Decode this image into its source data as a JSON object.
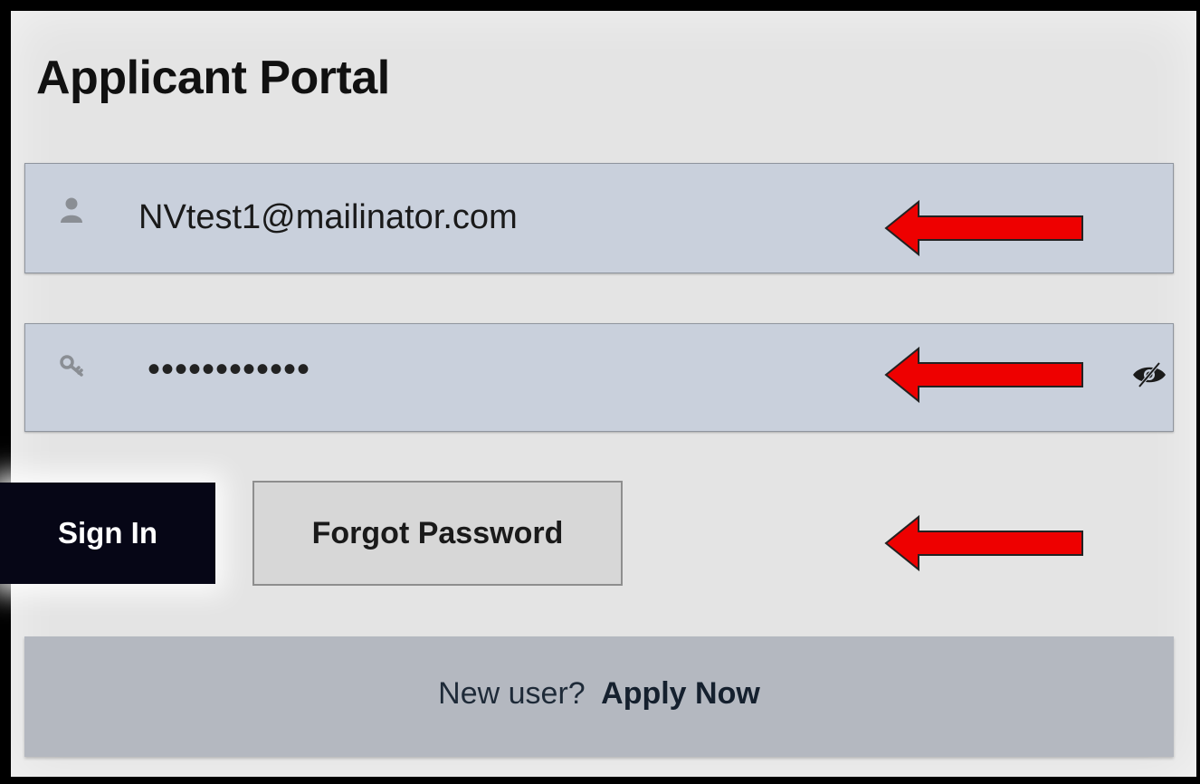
{
  "page": {
    "title": "Applicant Portal"
  },
  "login_form": {
    "email_value": "NVtest1@mailinator.com",
    "password_masked": "••••••••••••",
    "sign_in_label": "Sign In",
    "forgot_password_label": "Forgot Password"
  },
  "footer": {
    "new_user_text": "New user?",
    "apply_now_label": "Apply Now"
  },
  "icons": {
    "email_field": "user-icon",
    "password_field": "key-icon",
    "password_toggle": "eye-slash-icon",
    "annotations": "red-arrow-icon"
  },
  "colors": {
    "field_bg": "#c9d0dc",
    "sign_in_bg": "#060616",
    "footer_bg": "#b4b8c0",
    "annotation_arrow": "#ee0000"
  }
}
